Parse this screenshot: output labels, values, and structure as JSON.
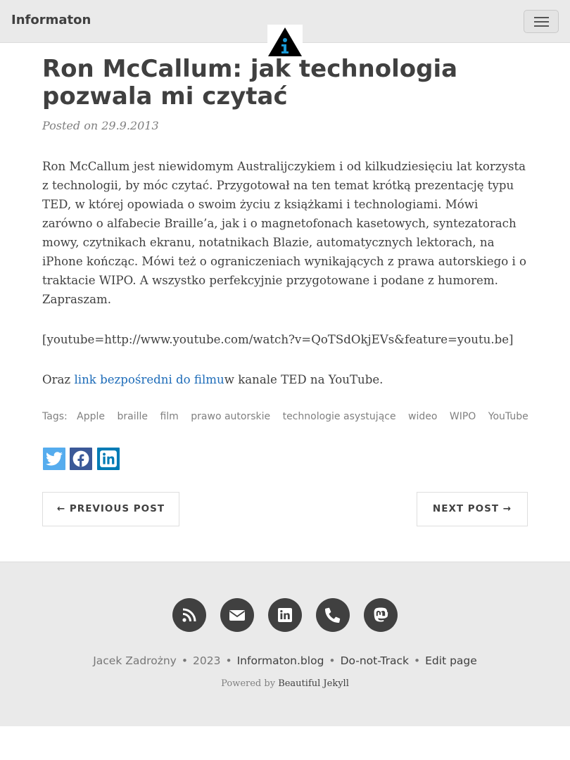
{
  "nav": {
    "brand": "Informaton"
  },
  "post": {
    "title": "Ron McCallum: jak technologia pozwala mi czytać",
    "meta": "Posted on 29.9.2013",
    "paragraph1": "Ron McCallum jest niewidomym Australijczykiem i od kilkudziesięciu lat korzysta z technologii, by móc czytać. Przygotował na ten temat krótką prezentację typu TED, w której opowiada o swoim życiu z książkami i technologiami. Mówi zarówno o alfabecie Braille’a, jak i o magnetofonach kasetowych, syntezatorach mowy, czytnikach ekranu, notatnikach Blazie, automatycznych lektorach, na iPhone kończąc. Mówi też o ograniczeniach wynikających z prawa autorskiego i o traktacie WIPO. A wszystko perfekcyjnie przygotowane i podane z humorem. Zapraszam.",
    "embed": "[youtube=http://www.youtube.com/watch?v=QoTSdOkjEVs&feature=youtu.be]",
    "p3_prefix": "Oraz ",
    "p3_link": "link bezpośredni do filmu",
    "p3_suffix": "w kanale TED na YouTube."
  },
  "tags": {
    "label": "Tags:",
    "items": [
      "Apple",
      "braille",
      "film",
      "prawo autorskie",
      "technologie asystujące",
      "wideo",
      "WIPO",
      "YouTube"
    ]
  },
  "share": {
    "icons": [
      "twitter-icon",
      "facebook-icon",
      "linkedin-icon"
    ],
    "colors": {
      "twitter": "#55acee",
      "facebook": "#3b5998",
      "linkedin": "#007bb5"
    }
  },
  "pager": {
    "prev": "← PREVIOUS POST",
    "next": "NEXT POST →"
  },
  "footer": {
    "icons": [
      "rss-icon",
      "envelope-icon",
      "linkedin-icon",
      "phone-icon",
      "mastodon-icon"
    ],
    "author": "Jacek Zadrożny",
    "year": "2023",
    "site": "Informaton.blog",
    "dnt": "Do-not-Track",
    "edit": "Edit page",
    "powered_prefix": "Powered by",
    "powered_link": "Beautiful Jekyll"
  }
}
